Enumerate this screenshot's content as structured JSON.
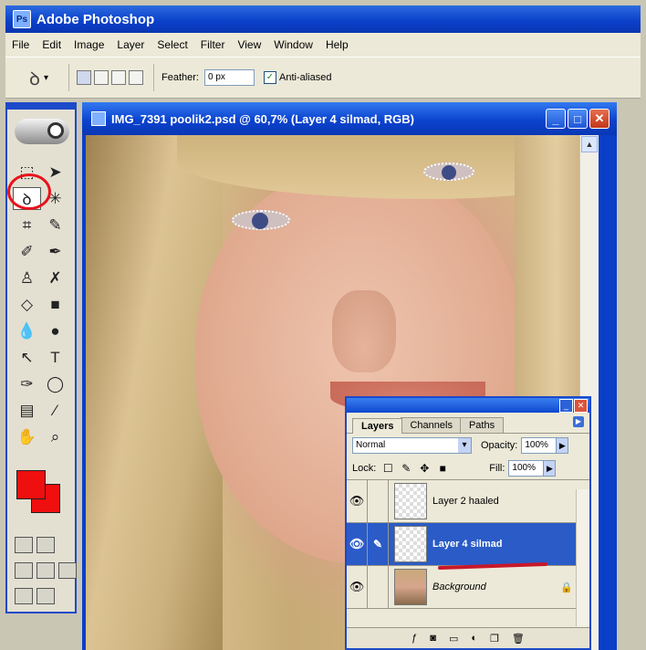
{
  "app": {
    "title": "Adobe Photoshop",
    "icon": "photoshop-icon"
  },
  "menu": [
    "File",
    "Edit",
    "Image",
    "Layer",
    "Select",
    "Filter",
    "View",
    "Window",
    "Help"
  ],
  "options": {
    "tool_icon": "lasso-icon",
    "feather_label": "Feather:",
    "feather_value": "0 px",
    "antialiased_label": "Anti-aliased",
    "antialiased_checked": true
  },
  "toolbox": {
    "foreground_color": "#f00f0f",
    "background_color": "#f00f0f",
    "selected_tool": "lasso-icon"
  },
  "document": {
    "title": "IMG_7391 poolik2.psd @ 60,7% (Layer 4 silmad, RGB)",
    "buttons": [
      "minimize",
      "maximize",
      "close"
    ]
  },
  "layers_panel": {
    "tabs": [
      "Layers",
      "Channels",
      "Paths"
    ],
    "active_tab": "Layers",
    "blend_mode": "Normal",
    "opacity_label": "Opacity:",
    "opacity_value": "100%",
    "lock_label": "Lock:",
    "fill_label": "Fill:",
    "fill_value": "100%",
    "layers": [
      {
        "name": "Layer 2 haaled",
        "visible": true,
        "selected": false
      },
      {
        "name": "Layer 4 silmad",
        "visible": true,
        "selected": true
      },
      {
        "name": "Background",
        "visible": true,
        "selected": false,
        "locked": true
      }
    ]
  }
}
